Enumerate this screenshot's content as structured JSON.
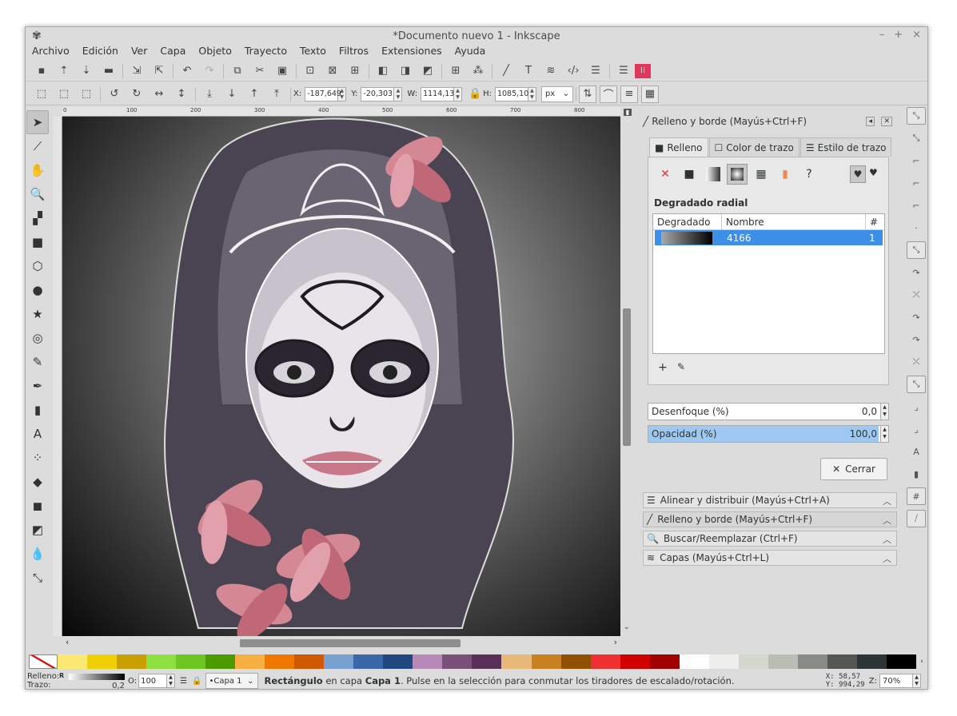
{
  "window": {
    "title": "*Documento nuevo 1 - Inkscape"
  },
  "menu": [
    "Archivo",
    "Edición",
    "Ver",
    "Capa",
    "Objeto",
    "Trayecto",
    "Texto",
    "Filtros",
    "Extensiones",
    "Ayuda"
  ],
  "toolbar2": {
    "x_label": "X:",
    "x_value": "-187,649",
    "y_label": "Y:",
    "y_value": "-20,303",
    "w_label": "W:",
    "w_value": "1114,13",
    "h_label": "H:",
    "h_value": "1085,10",
    "unit": "px"
  },
  "ruler_h": [
    "0",
    "100",
    "200",
    "300",
    "400",
    "500",
    "600",
    "700",
    "800"
  ],
  "panel": {
    "title": "Relleno y borde (Mayús+Ctrl+F)",
    "tabs": [
      "Relleno",
      "Color de trazo",
      "Estilo de trazo"
    ],
    "paint_mode": "Degradado radial",
    "list_headers": {
      "gradient": "Degradado",
      "name": "Nombre",
      "count": "#"
    },
    "list_row": {
      "name": "4166",
      "count": "1"
    },
    "blur_label": "Desenfoque (%)",
    "blur_value": "0,0",
    "opacity_label": "Opacidad (%)",
    "opacity_value": "100,0",
    "close_label": "Cerrar"
  },
  "docked": [
    "Alinear y distribuir (Mayús+Ctrl+A)",
    "Relleno y borde (Mayús+Ctrl+F)",
    "Buscar/Reemplazar (Ctrl+F)",
    "Capas (Mayús+Ctrl+L)"
  ],
  "palette": [
    "#fbe870",
    "#f0d000",
    "#c8a000",
    "#8de040",
    "#6cc820",
    "#4a9a00",
    "#f8b040",
    "#f07800",
    "#d05800",
    "#78a0d0",
    "#3868a8",
    "#204880",
    "#b888b8",
    "#785078",
    "#583058",
    "#e8b878",
    "#c88020",
    "#905000",
    "#f03030",
    "#d00000",
    "#a00000",
    "#ffffff",
    "#eeeeec",
    "#d3d7cf",
    "#babdb6",
    "#888a85",
    "#555753",
    "#2e3436",
    "#000000"
  ],
  "status": {
    "fill_label": "Relleno:",
    "fill_value": "R",
    "stroke_label": "Trazo:",
    "stroke_value": "0,2",
    "opacity_label": "O:",
    "opacity_value": "100",
    "layer": "•Capa 1",
    "message_bold": "Rectángulo",
    "message_mid": " en capa ",
    "message_layer": "Capa 1",
    "message_rest": ". Pulse en la selección para conmutar los tiradores de escalado/rotación.",
    "x_label": "X:",
    "x_value": "58,57",
    "y_label": "Y:",
    "y_value": "994,29",
    "zoom_label": "Z:",
    "zoom_value": "70%"
  }
}
